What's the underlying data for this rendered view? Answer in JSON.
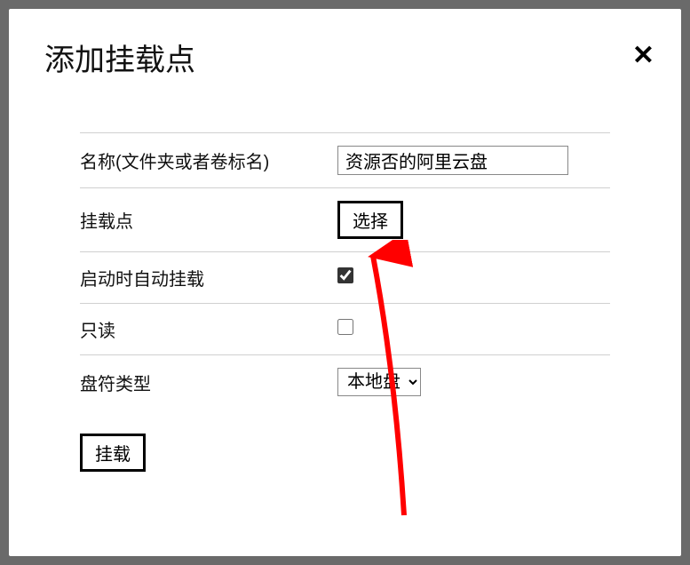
{
  "modal": {
    "title": "添加挂载点",
    "close_label": "✕"
  },
  "form": {
    "name": {
      "label": "名称(文件夹或者卷标名)",
      "value": "资源否的阿里云盘"
    },
    "mount_point": {
      "label": "挂载点",
      "select_button": "选择"
    },
    "auto_mount": {
      "label": "启动时自动挂载",
      "checked": true
    },
    "read_only": {
      "label": "只读",
      "checked": false
    },
    "drive_type": {
      "label": "盘符类型",
      "selected": "本地盘",
      "options": [
        "本地盘"
      ]
    },
    "submit_label": "挂载"
  },
  "annotation": {
    "arrow_color": "#ff0000"
  }
}
